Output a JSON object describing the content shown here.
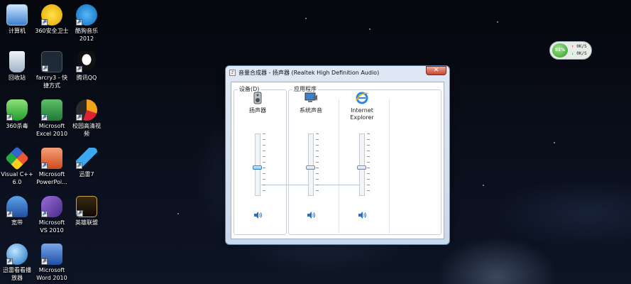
{
  "desktop": {
    "icons": [
      {
        "label": "计算机",
        "shortcut": false
      },
      {
        "label": "360安全卫士",
        "shortcut": true
      },
      {
        "label": "酷狗音乐\n2012",
        "shortcut": true
      },
      {
        "label": "回收站",
        "shortcut": false
      },
      {
        "label": "farcry3 - 快\n捷方式",
        "shortcut": true
      },
      {
        "label": "腾讯QQ",
        "shortcut": true
      },
      {
        "label": "360杀毒",
        "shortcut": true
      },
      {
        "label": "Microsoft\nExcel 2010",
        "shortcut": true
      },
      {
        "label": "校园高清视\n频",
        "shortcut": true
      },
      {
        "label": "Visual C++\n6.0",
        "shortcut": true
      },
      {
        "label": "Microsoft\nPowerPoi...",
        "shortcut": true
      },
      {
        "label": "迅雷7",
        "shortcut": true
      },
      {
        "label": "宽带",
        "shortcut": true
      },
      {
        "label": "Microsoft\nVS 2010",
        "shortcut": true
      },
      {
        "label": "英雄联盟",
        "shortcut": true
      },
      {
        "label": "迅雷看看播\n放器",
        "shortcut": true
      },
      {
        "label": "Microsoft\nWord 2010",
        "shortcut": true
      }
    ]
  },
  "net_widget": {
    "percent": "51%",
    "up": "0K/S",
    "down": "0K/S"
  },
  "mixer": {
    "title": "音量合成器 - 扬声器 (Realtek High Definition Audio)",
    "close_label": "✕",
    "device_group_label": "设备(D)",
    "apps_group_label": "应用程序",
    "channels": [
      {
        "name": "扬声器",
        "level": 0.45,
        "selected": true
      },
      {
        "name": "系统声音",
        "level": 0.45,
        "selected": false
      },
      {
        "name": "Internet\nExplorer",
        "level": 0.45,
        "selected": false
      }
    ]
  },
  "colors": {
    "accent": "#3a86c4",
    "titlebar": "#dfe9f5",
    "close": "#c5452f"
  }
}
